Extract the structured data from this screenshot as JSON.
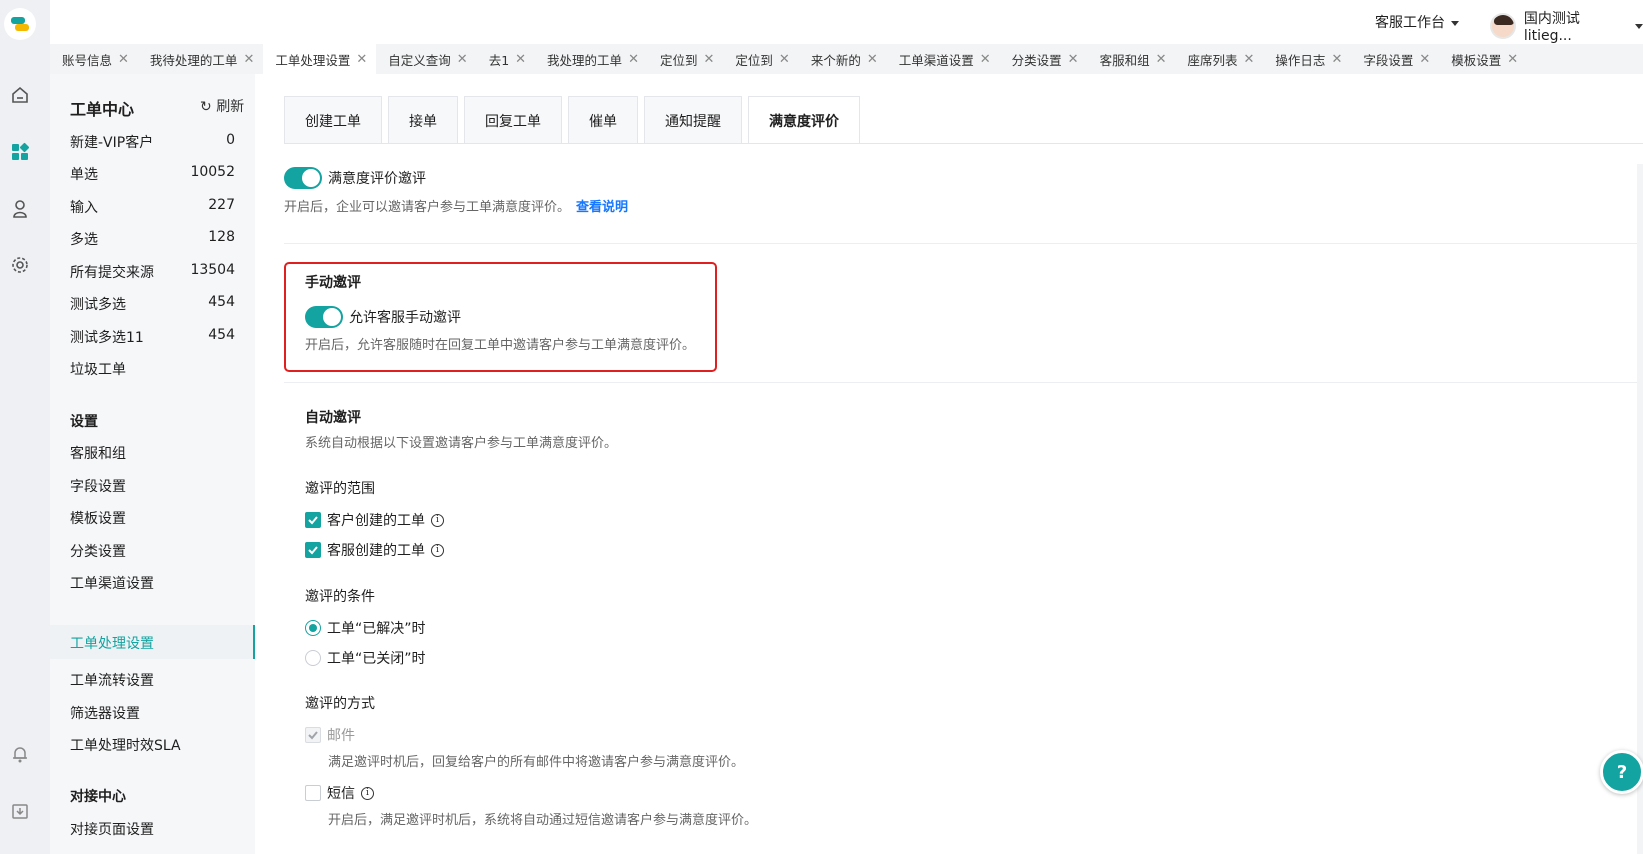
{
  "topbar": {
    "workspace": "客服工作台",
    "user_name": "国内测试litieg..."
  },
  "tabs": [
    {
      "label": "账号信息"
    },
    {
      "label": "我待处理的工单"
    },
    {
      "label": "工单处理设置",
      "active": true
    },
    {
      "label": "自定义查询"
    },
    {
      "label": "去1"
    },
    {
      "label": "我处理的工单"
    },
    {
      "label": "定位到"
    },
    {
      "label": "定位到"
    },
    {
      "label": "来个新的"
    },
    {
      "label": "工单渠道设置"
    },
    {
      "label": "分类设置"
    },
    {
      "label": "客服和组"
    },
    {
      "label": "座席列表"
    },
    {
      "label": "操作日志"
    },
    {
      "label": "字段设置"
    },
    {
      "label": "模板设置"
    }
  ],
  "nav": {
    "title": "工单中心",
    "refresh": "刷新",
    "views": [
      {
        "label": "新建-VIP客户",
        "count": "0"
      },
      {
        "label": "单选",
        "count": "10052"
      },
      {
        "label": "输入",
        "count": "227"
      },
      {
        "label": "多选",
        "count": "128"
      },
      {
        "label": "所有提交来源",
        "count": "13504"
      },
      {
        "label": "测试多选",
        "count": "454"
      },
      {
        "label": "测试多选11",
        "count": "454"
      },
      {
        "label": "垃圾工单",
        "count": ""
      }
    ],
    "settings_title": "设置",
    "settings": [
      {
        "label": "客服和组"
      },
      {
        "label": "字段设置"
      },
      {
        "label": "模板设置"
      },
      {
        "label": "分类设置"
      },
      {
        "label": "工单渠道设置"
      },
      {
        "label": "工单处理设置",
        "active": true
      },
      {
        "label": "工单流转设置"
      },
      {
        "label": "筛选器设置"
      },
      {
        "label": "工单处理时效SLA"
      }
    ],
    "integration_title": "对接中心",
    "integration": [
      {
        "label": "对接页面设置"
      }
    ]
  },
  "subtabs": [
    "创建工单",
    "接单",
    "回复工单",
    "催单",
    "通知提醒",
    "满意度评价"
  ],
  "satisfaction": {
    "toggle_label": "满意度评价邀评",
    "desc": "开启后，企业可以邀请客户参与工单满意度评价。",
    "link": "查看说明"
  },
  "manual": {
    "title": "手动邀评",
    "toggle_label": "允许客服手动邀评",
    "desc": "开启后，允许客服随时在回复工单中邀请客户参与工单满意度评价。"
  },
  "auto": {
    "title": "自动邀评",
    "desc": "系统自动根据以下设置邀请客户参与工单满意度评价。",
    "scope_title": "邀评的范围",
    "scope": [
      "客户创建的工单",
      "客服创建的工单"
    ],
    "condition_title": "邀评的条件",
    "conditions": [
      "工单“已解决”时",
      "工单“已关闭”时"
    ],
    "method_title": "邀评的方式",
    "email_label": "邮件",
    "email_desc": "满足邀评时机后，回复给客户的所有邮件中将邀请客户参与满意度评价。",
    "sms_label": "短信",
    "sms_desc": "开启后，满足邀评时机后，系统将自动通过短信邀请客户参与满意度评价。"
  },
  "colors": {
    "accent": "#13a3a0",
    "highlight": "#e02020",
    "link": "#1677ff"
  }
}
